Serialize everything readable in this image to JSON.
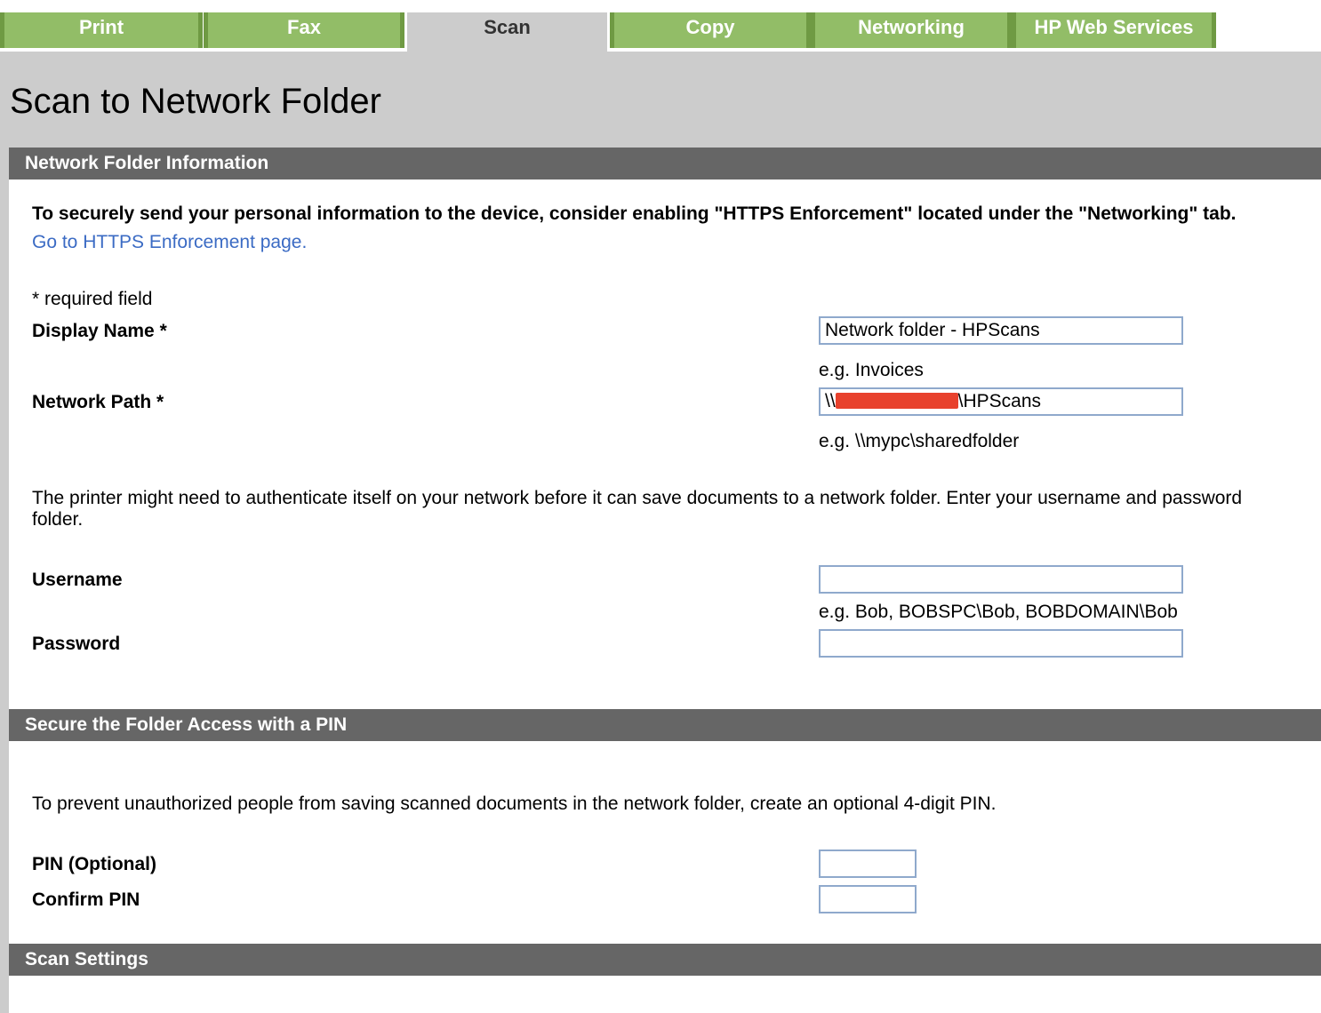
{
  "tabs": [
    {
      "label": "Print",
      "active": false
    },
    {
      "label": "Fax",
      "active": false
    },
    {
      "label": "Scan",
      "active": true
    },
    {
      "label": "Copy",
      "active": false
    },
    {
      "label": "Networking",
      "active": false
    },
    {
      "label": "HP Web Services",
      "active": false
    }
  ],
  "page": {
    "title": "Scan to Network Folder"
  },
  "sections": {
    "network_folder": "Network Folder Information",
    "secure_pin": "Secure the Folder Access with a PIN",
    "scan_settings": "Scan Settings"
  },
  "network_folder": {
    "https_notice": "To securely send your personal information to the device, consider enabling \"HTTPS Enforcement\" located under the \"Networking\" tab.",
    "https_link": "Go to HTTPS Enforcement page.",
    "required_note": "* required field",
    "display_name": {
      "label": "Display Name *",
      "value": "Network folder - HPScans",
      "hint": "e.g. Invoices"
    },
    "network_path": {
      "label": "Network Path *",
      "prefix": "\\\\",
      "suffix": "\\HPScans",
      "hint": "e.g. \\\\mypc\\sharedfolder"
    },
    "auth_notice_line1": "The printer might need to authenticate itself on your network before it can save documents to a network folder. Enter your username and password",
    "auth_notice_line2": "folder.",
    "username": {
      "label": "Username",
      "value": "",
      "hint": "e.g. Bob, BOBSPC\\Bob, BOBDOMAIN\\Bob"
    },
    "password": {
      "label": "Password",
      "value": ""
    }
  },
  "pin": {
    "notice": "To prevent unauthorized people from saving scanned documents in the network folder, create an optional 4-digit PIN.",
    "pin_label": "PIN (Optional)",
    "confirm_label": "Confirm PIN"
  },
  "colors": {
    "tab_green": "#92bd67",
    "tab_border": "#6f9a43",
    "section_gray": "#666666",
    "link_blue": "#3b6bc4",
    "input_border": "#8fa9cc"
  }
}
